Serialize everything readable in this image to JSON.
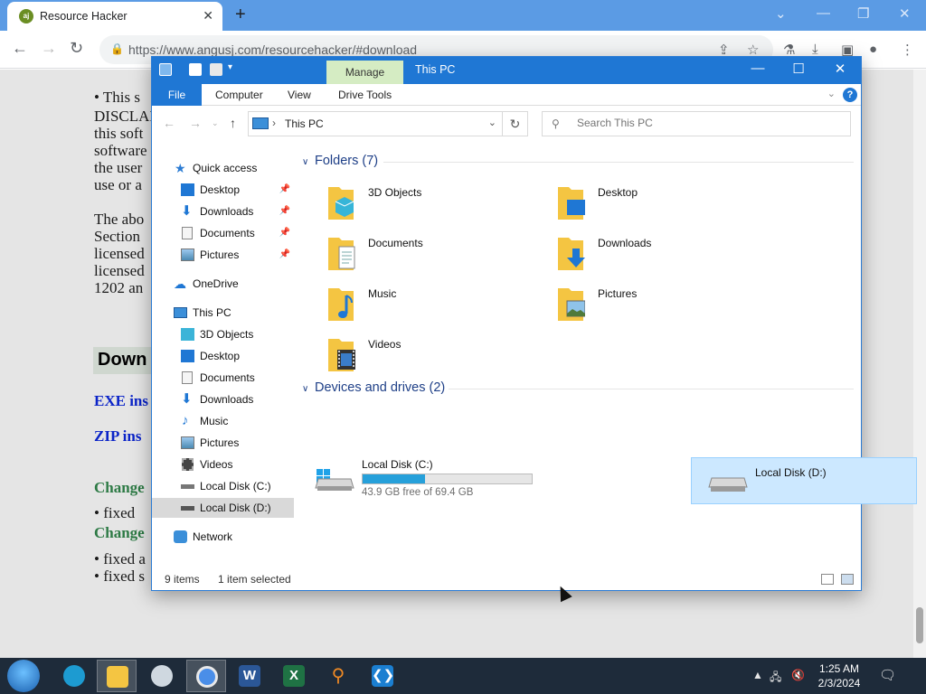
{
  "browser": {
    "tab_title": "Resource Hacker",
    "tab_favicon_text": "aj",
    "url": "https://www.angusj.com/resourcehacker/#download",
    "icons": [
      "back-icon",
      "forward-icon",
      "reload-icon",
      "lock-icon",
      "share-icon",
      "bookmark-star-icon",
      "extensions-icon",
      "download-icon",
      "sidepanel-icon",
      "profile-icon",
      "menu-icon"
    ]
  },
  "webpage": {
    "lines": [
      "• This s",
      "DISCLAI",
      "this soft",
      "software",
      "the user",
      "use or a"
    ],
    "para2": [
      "The abo",
      "Section",
      "licensed",
      "licensed",
      "1202 an"
    ],
    "download_heading": "Down",
    "exe_link": "EXE ins",
    "zip_link": "ZIP ins",
    "changes1": "Change",
    "bullet1": "• fixed",
    "changes2": "Change",
    "bullet2": "• fixed a",
    "bullet3": "• fixed s"
  },
  "explorer": {
    "title": "This PC",
    "contextual_tab": "Manage",
    "ribbon_tabs": [
      "File",
      "Computer",
      "View",
      "Drive Tools"
    ],
    "address_crumb": "This PC",
    "search_placeholder": "Search This PC",
    "nav": {
      "quick_access": "Quick access",
      "qa_items": [
        "Desktop",
        "Downloads",
        "Documents",
        "Pictures"
      ],
      "onedrive": "OneDrive",
      "this_pc": "This PC",
      "pc_items": [
        "3D Objects",
        "Desktop",
        "Documents",
        "Downloads",
        "Music",
        "Pictures",
        "Videos",
        "Local Disk (C:)",
        "Local Disk (D:)"
      ],
      "network": "Network"
    },
    "folders_header": "Folders (7)",
    "folders": [
      "3D Objects",
      "Desktop",
      "Documents",
      "Downloads",
      "Music",
      "Pictures",
      "Videos"
    ],
    "drives_header": "Devices and drives (2)",
    "drives": [
      {
        "name": "Local Disk (C:)",
        "free_text": "43.9 GB free of 69.4 GB",
        "used_fraction": 0.367
      },
      {
        "name": "Local Disk (D:)"
      }
    ],
    "status": {
      "items": "9 items",
      "selected": "1 item selected"
    }
  },
  "taskbar": {
    "apps": [
      "file-explorer",
      "edge",
      "paint",
      "chrome",
      "word",
      "excel",
      "search-tool",
      "vscode"
    ],
    "time": "1:25 AM",
    "date": "2/3/2024"
  },
  "colors": {
    "accent": "#1f77d4",
    "manage_tab": "#d5ecc3",
    "selection": "#cce8ff",
    "drive_bar": "#26a0da"
  }
}
